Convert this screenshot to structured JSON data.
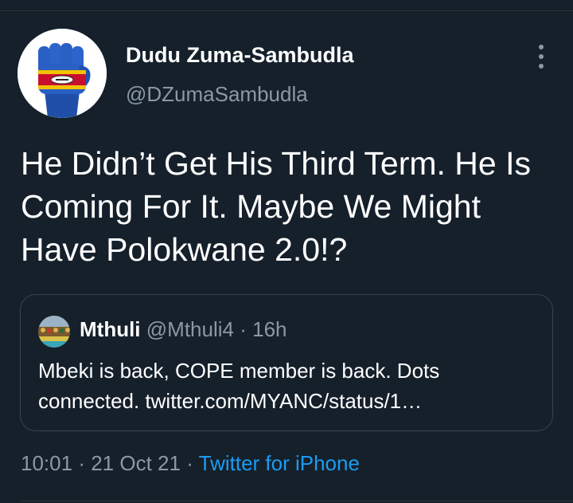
{
  "tweet": {
    "author": {
      "display_name": "Dudu Zuma-Sambudla",
      "handle": "@DZumaSambudla",
      "avatar_icon": "raised-fist-flag-icon"
    },
    "more_icon": "vertical-ellipsis-icon",
    "text": "He Didn’t Get His Third Term. He Is Coming For It. Maybe We Might Have Polokwane 2.0!?",
    "quoted_tweet": {
      "display_name": "Mthuli",
      "handle": "@Mthuli4",
      "separator": "·",
      "time_ago": "16h",
      "text": "Mbeki is back, COPE member is back. Dots connected. twitter.com/MYANC/status/1…"
    },
    "footer": {
      "time": "10:01",
      "separator": "·",
      "date": "21 Oct 21",
      "source": "Twitter for iPhone"
    }
  },
  "colors": {
    "background": "#15202b",
    "text_primary": "#ffffff",
    "text_secondary": "#8b98a5",
    "link": "#1d9bf0",
    "border": "#38444d"
  }
}
